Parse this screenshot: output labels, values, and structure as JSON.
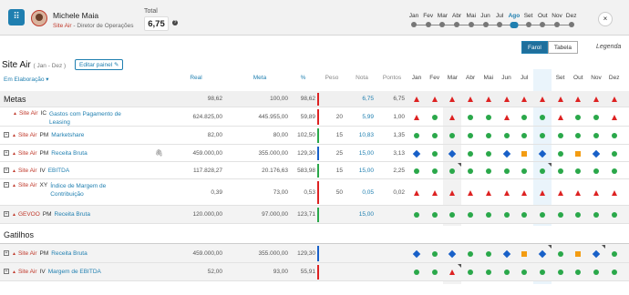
{
  "topbar": {
    "user_name": "Michele Maia",
    "user_company": "Site Air",
    "user_role": "Diretor de Operações",
    "total_label": "Total",
    "total_value": "6,75",
    "info": "?",
    "close": "×",
    "grid_icon": "⠿"
  },
  "timeline": {
    "months": [
      "Jan",
      "Fev",
      "Mar",
      "Abr",
      "Mai",
      "Jun",
      "Jul",
      "Ago",
      "Set",
      "Out",
      "Nov",
      "Dez"
    ],
    "selected_index": 7
  },
  "view": {
    "farol_label": "Farol",
    "tabela_label": "Tabela",
    "legenda": "Legenda"
  },
  "org": {
    "name": "Site Air",
    "period": "( Jan - Dez )",
    "edit_label": "Editar painel",
    "status": "Em Elaboração"
  },
  "columns": {
    "real": "Real",
    "meta": "Meta",
    "pct": "%",
    "peso": "Peso",
    "nota": "Nota",
    "pontos": "Pontos"
  },
  "colors": {
    "red": "#d22",
    "green": "#2aa84a",
    "blue": "#1860c8",
    "orange": "#f39c12",
    "accent": "#1f7fb0"
  },
  "sections": [
    {
      "title": "Metas",
      "real": "98,62",
      "meta": "100,00",
      "pct": "98,62",
      "nota": "6,75",
      "pontos": "6,75",
      "bar": "red",
      "marks": [
        "t",
        "t",
        "t",
        "t",
        "t",
        "t",
        "t",
        "t",
        "t",
        "t",
        "t",
        "t"
      ],
      "rows": [
        {
          "expand": "",
          "company": "Site Air",
          "type": "IC",
          "indicator": "Gastos com Pagamento de Leasing",
          "real": "624.825,00",
          "meta": "445.955,00",
          "pct": "59,89",
          "bar": "red",
          "peso": "20",
          "nota": "5,99",
          "pontos": "1,00",
          "marks": [
            "t",
            "o",
            "t",
            "o",
            "o",
            "t",
            "o",
            "o",
            "t",
            "o",
            "o",
            "t"
          ],
          "corners": []
        },
        {
          "expand": "+",
          "company": "Site Air",
          "type": "PM",
          "indicator": "Marketshare",
          "real": "82,00",
          "meta": "80,00",
          "pct": "102,50",
          "bar": "green",
          "peso": "15",
          "nota": "10,83",
          "pontos": "1,35",
          "marks": [
            "o",
            "o",
            "o",
            "o",
            "o",
            "o",
            "o",
            "o",
            "o",
            "o",
            "o",
            "o"
          ],
          "corners": []
        },
        {
          "expand": "+",
          "company": "Site Air",
          "type": "PM",
          "indicator": "Receita Bruta",
          "real": "459.000,00",
          "meta": "355.000,00",
          "pct": "129,30",
          "bar": "blue",
          "peso": "25",
          "nota": "15,00",
          "pontos": "3,13",
          "marks": [
            "d",
            "o",
            "d",
            "o",
            "o",
            "d",
            "s",
            "d",
            "o",
            "s",
            "d",
            "o"
          ],
          "corners": [],
          "clip": true
        },
        {
          "expand": "+",
          "company": "Site Air",
          "type": "IV",
          "indicator": "EBITDA",
          "real": "117.828,27",
          "meta": "20.176,63",
          "pct": "583,98",
          "bar": "green",
          "peso": "15",
          "nota": "15,00",
          "pontos": "2,25",
          "marks": [
            "o",
            "o",
            "o",
            "o",
            "o",
            "o",
            "o",
            "o",
            "o",
            "o",
            "o",
            "o"
          ],
          "corners": [
            2,
            7
          ]
        },
        {
          "expand": "+",
          "company": "Site Air",
          "type": "XY",
          "indicator": "Índice de Margem de Contribuição",
          "real": "0,39",
          "meta": "73,00",
          "pct": "0,53",
          "bar": "red",
          "peso": "50",
          "nota": "0,05",
          "pontos": "0,02",
          "marks": [
            "t",
            "t",
            "t",
            "t",
            "t",
            "t",
            "t",
            "t",
            "t",
            "t",
            "t",
            "t"
          ],
          "corners": []
        },
        {
          "expand": "+",
          "company": "GEVOO",
          "type": "PM",
          "indicator": "Receita Bruta",
          "real": "120.000,00",
          "meta": "97.000,00",
          "pct": "123,71",
          "bar": "green",
          "peso": "",
          "nota": "15,00",
          "pontos": "",
          "marks": [
            "o",
            "o",
            "o",
            "o",
            "o",
            "o",
            "o",
            "o",
            "o",
            "o",
            "o",
            "o"
          ],
          "corners": [],
          "shaded": true
        }
      ]
    },
    {
      "title": "Gatilhos",
      "rows": [
        {
          "expand": "+",
          "company": "Site Air",
          "type": "PM",
          "indicator": "Receita Bruta",
          "real": "459.000,00",
          "meta": "355.000,00",
          "pct": "129,30",
          "bar": "blue",
          "peso": "",
          "nota": "",
          "pontos": "",
          "marks": [
            "d",
            "o",
            "d",
            "o",
            "o",
            "d",
            "s",
            "d",
            "o",
            "s",
            "d",
            "o"
          ],
          "corners": [
            7,
            10
          ],
          "shaded": true
        },
        {
          "expand": "+",
          "company": "Site Air",
          "type": "IV",
          "indicator": "Margem de EBITDA",
          "real": "52,00",
          "meta": "93,00",
          "pct": "55,91",
          "bar": "red",
          "peso": "",
          "nota": "",
          "pontos": "",
          "marks": [
            "o",
            "o",
            "t",
            "o",
            "o",
            "o",
            "o",
            "o",
            "o",
            "o",
            "o",
            "o"
          ],
          "corners": [
            2
          ],
          "shaded": true
        }
      ]
    }
  ]
}
